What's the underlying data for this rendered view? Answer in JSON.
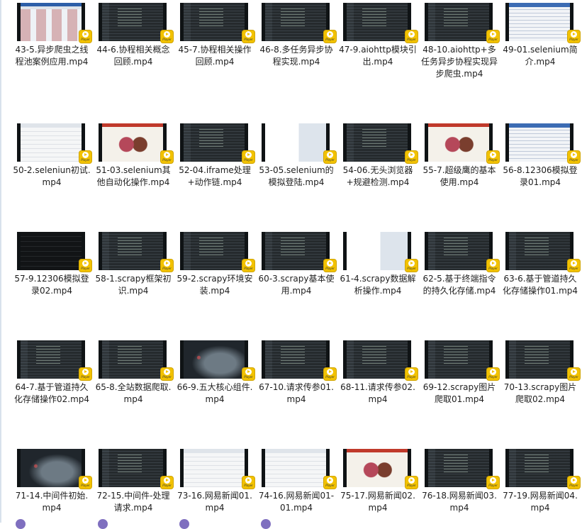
{
  "player_badge_text": "Player",
  "badge_color": "#f2c200",
  "files": [
    {
      "name": "43-5.异步爬虫之线程池案例应用.mp4",
      "thumb": "web"
    },
    {
      "name": "44-6.协程相关概念回顾.mp4",
      "thumb": "code"
    },
    {
      "name": "45-7.协程相关操作回顾.mp4",
      "thumb": "code"
    },
    {
      "name": "46-8.多任务异步协程实现.mp4",
      "thumb": "code"
    },
    {
      "name": "47-9.aiohttp模块引出.mp4",
      "thumb": "code"
    },
    {
      "name": "48-10.aiohttp+多任务异步协程实现异步爬虫.mp4",
      "thumb": "code"
    },
    {
      "name": "49-01.selenium简介.mp4",
      "thumb": "table"
    },
    {
      "name": "50-2.seleniun初试.mp4",
      "thumb": "white"
    },
    {
      "name": "51-03.selenium其他自动化操作.mp4",
      "thumb": "photo"
    },
    {
      "name": "52-04.iframe处理+动作链.mp4",
      "thumb": "code"
    },
    {
      "name": "53-05.selenium的模拟登陆.mp4",
      "thumb": "mixed"
    },
    {
      "name": "54-06.无头浏览器+规避检测.mp4",
      "thumb": "code"
    },
    {
      "name": "55-7.超级鹰的基本使用.mp4",
      "thumb": "photo"
    },
    {
      "name": "56-8.12306模拟登录01.mp4",
      "thumb": "table"
    },
    {
      "name": "57-9.12306模拟登录02.mp4",
      "thumb": "dark"
    },
    {
      "name": "58-1.scrapy框架初识.mp4",
      "thumb": "code"
    },
    {
      "name": "59-2.scrapy环境安装.mp4",
      "thumb": "code"
    },
    {
      "name": "60-3.scrapy基本使用.mp4",
      "thumb": "code"
    },
    {
      "name": "61-4.scrapy数据解析操作.mp4",
      "thumb": "mixed"
    },
    {
      "name": "62-5.基于终端指令的持久化存储.mp4",
      "thumb": "code"
    },
    {
      "name": "63-6.基于管道持久化存储操作01.mp4",
      "thumb": "code"
    },
    {
      "name": "64-7.基于管道持久化存储操作02.mp4",
      "thumb": "code"
    },
    {
      "name": "65-8.全站数据爬取.mp4",
      "thumb": "code"
    },
    {
      "name": "66-9.五大核心组件.mp4",
      "thumb": "space"
    },
    {
      "name": "67-10.请求传参01.mp4",
      "thumb": "code"
    },
    {
      "name": "68-11.请求传参02.mp4",
      "thumb": "code"
    },
    {
      "name": "69-12.scrapy图片爬取01.mp4",
      "thumb": "code"
    },
    {
      "name": "70-13.scrapy图片爬取02.mp4",
      "thumb": "code"
    },
    {
      "name": "71-14.中间件初始.mp4",
      "thumb": "space"
    },
    {
      "name": "72-15.中间件-处理请求.mp4",
      "thumb": "code"
    },
    {
      "name": "73-16.网易新闻01.mp4",
      "thumb": "white"
    },
    {
      "name": "74-16.网易新闻01-01.mp4",
      "thumb": "white"
    },
    {
      "name": "75-17.网易新闻02.mp4",
      "thumb": "photo"
    },
    {
      "name": "76-18.网易新闻03.mp4",
      "thumb": "code"
    },
    {
      "name": "77-19.网易新闻04.mp4",
      "thumb": "code"
    }
  ]
}
